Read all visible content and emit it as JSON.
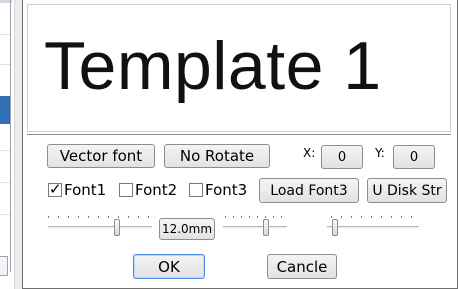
{
  "preview": {
    "text": "Template 1"
  },
  "toolbar": {
    "font_type_label": "Vector font",
    "rotate_label": "No Rotate",
    "x_label": "X:",
    "x_value": "0",
    "y_label": "Y:",
    "y_value": "0"
  },
  "fonts": {
    "font1": {
      "label": "Font1",
      "checked": true
    },
    "font2": {
      "label": "Font2",
      "checked": false
    },
    "font3": {
      "label": "Font3",
      "checked": false
    },
    "load_font3_label": "Load Font3",
    "udisk_label": "U Disk Str"
  },
  "size": {
    "value_label": "12.0mm"
  },
  "actions": {
    "ok_label": "OK",
    "cancel_label": "Cancle"
  }
}
